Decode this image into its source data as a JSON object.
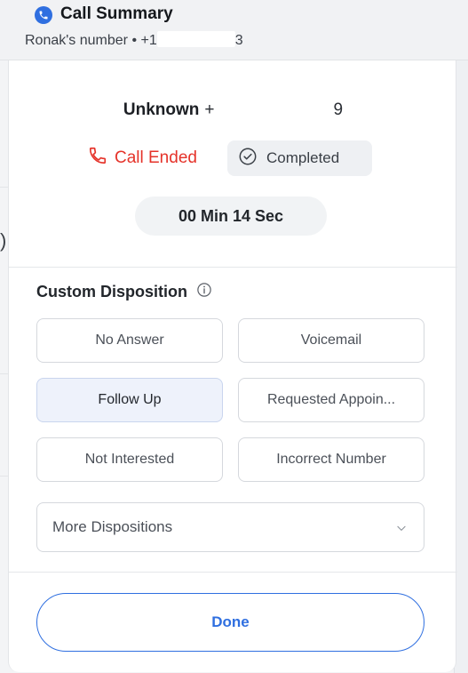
{
  "header": {
    "title": "Call Summary",
    "subtitle_prefix": "Ronak's number • +1",
    "subtitle_suffix": "3",
    "icon": "phone-icon"
  },
  "caller": {
    "name": "Unknown",
    "number_prefix": "+",
    "number_suffix": "9"
  },
  "status": {
    "call_state": "Call Ended",
    "call_state_icon": "phone-hangup-icon",
    "result": "Completed",
    "result_icon": "check-circle-icon"
  },
  "duration": "00 Min 14 Sec",
  "disposition": {
    "title": "Custom Disposition",
    "info_icon": "info-icon",
    "options": [
      "No Answer",
      "Voicemail",
      "Follow Up",
      "Requested Appoin...",
      "Not Interested",
      "Incorrect Number"
    ],
    "selected": "Follow Up",
    "more_label": "More Dispositions"
  },
  "done_label": "Done",
  "colors": {
    "accent": "#2f6fe0",
    "danger": "#e5332a",
    "selected_bg": "#eef2fb"
  }
}
